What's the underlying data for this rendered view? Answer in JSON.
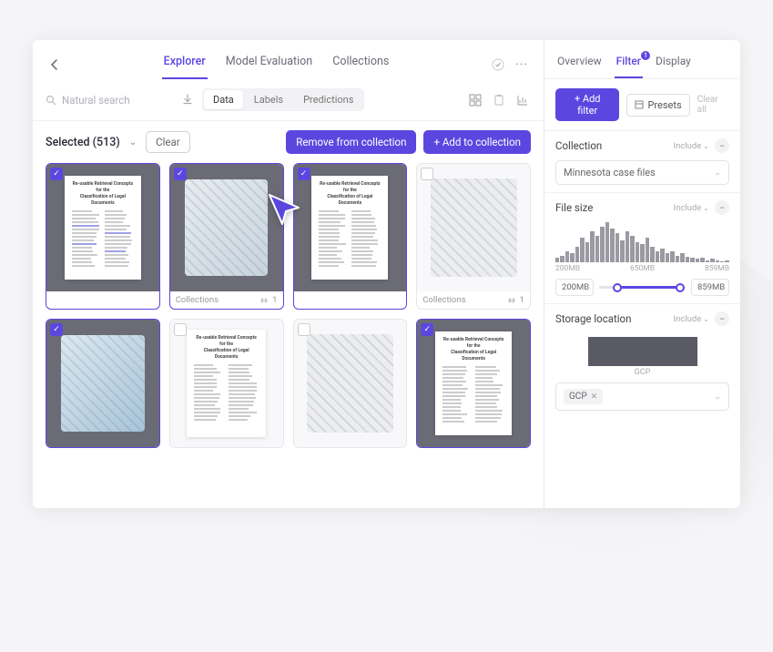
{
  "topTabs": [
    {
      "label": "Explorer",
      "active": true
    },
    {
      "label": "Model Evaluation",
      "active": false
    },
    {
      "label": "Collections",
      "active": false
    }
  ],
  "search": {
    "placeholder": "Natural search"
  },
  "subTabs": [
    {
      "label": "Data",
      "active": true
    },
    {
      "label": "Labels",
      "active": false
    },
    {
      "label": "Predictions",
      "active": false
    }
  ],
  "selection": {
    "text": "Selected (513)",
    "clear": "Clear"
  },
  "actions": {
    "remove": "Remove from collection",
    "add": "+ Add to collection"
  },
  "cards": [
    {
      "type": "doc",
      "selected": true,
      "highlighted": true
    },
    {
      "type": "image",
      "variant": "binoc",
      "selected": true,
      "footer": {
        "label": "Collections",
        "count": "1"
      }
    },
    {
      "type": "doc",
      "selected": true
    },
    {
      "type": "image",
      "variant": "device",
      "selected": false,
      "footer": {
        "label": "Collections",
        "count": "1"
      }
    },
    {
      "type": "image",
      "variant": "shoe",
      "selected": true
    },
    {
      "type": "doc",
      "selected": false
    },
    {
      "type": "image",
      "variant": "device",
      "selected": false
    },
    {
      "type": "doc",
      "selected": true
    }
  ],
  "sideTabs": [
    {
      "label": "Overview",
      "active": false
    },
    {
      "label": "Filter",
      "active": true,
      "badge": "1"
    },
    {
      "label": "Display",
      "active": false
    }
  ],
  "filterBar": {
    "add": "+ Add filter",
    "presets": "Presets",
    "clearAll": "Clear all"
  },
  "filters": {
    "collection": {
      "title": "Collection",
      "include": "Include",
      "value": "Minnesota case files"
    },
    "filesize": {
      "title": "File size",
      "include": "Include",
      "labels": [
        "200MB",
        "650MB",
        "859MB"
      ],
      "min": "200MB",
      "max": "859MB",
      "bars": [
        4,
        6,
        10,
        8,
        14,
        22,
        18,
        28,
        24,
        32,
        36,
        30,
        26,
        20,
        28,
        24,
        18,
        16,
        22,
        14,
        10,
        12,
        8,
        10,
        6,
        8,
        5,
        4,
        3,
        4,
        2,
        3,
        2,
        1,
        2
      ]
    },
    "storage": {
      "title": "Storage location",
      "include": "Include",
      "label": "GCP",
      "chip": "GCP"
    }
  }
}
